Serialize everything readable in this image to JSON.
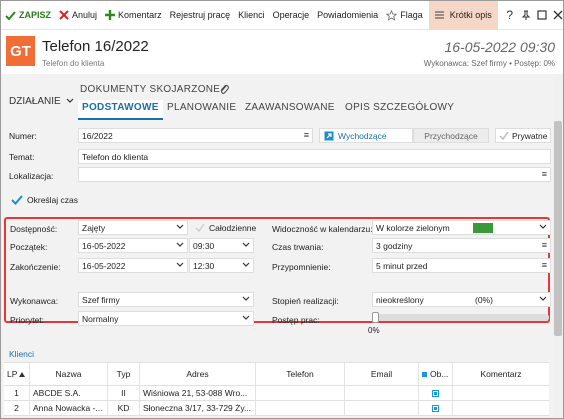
{
  "toolbar": {
    "save": "ZAPISZ",
    "cancel": "Anuluj",
    "comment": "Komentarz",
    "register_work": "Rejestruj pracę",
    "clients": "Klienci",
    "operations": "Operacje",
    "notifications": "Powiadomienia",
    "flag": "Flaga",
    "short_desc": "Krótki opis"
  },
  "header": {
    "badge": "GT",
    "title": "Telefon 16/2022",
    "subtitle": "Telefon do klienta",
    "date": "16-05-2022 09:30",
    "meta": "Wykonawca: Szef firmy  •  Postęp: 0%"
  },
  "tabs": {
    "action": "DZIAŁANIE",
    "documents": "DOKUMENTY SKOJARZONE",
    "items": [
      "PODSTAWOWE",
      "PLANOWANIE",
      "ZAAWANSOWANE",
      "OPIS SZCZEGÓŁOWY"
    ],
    "active": "PODSTAWOWE"
  },
  "form": {
    "number_label": "Numer:",
    "number_value": "16/2022",
    "direction_out": "Wychodzące",
    "direction_in": "Przychodzące",
    "private": "Prywatne",
    "topic_label": "Temat:",
    "topic_value": "Telefon do klienta",
    "location_label": "Lokalizacja:",
    "location_value": "",
    "set_time": "Określaj czas",
    "availability_label": "Dostępność:",
    "availability_value": "Zajęty",
    "all_day": "Całodzienne",
    "calendar_vis_label": "Widoczność w kalendarzu:",
    "calendar_vis_value": "W kolorze zielonym",
    "calendar_color": "#3a9a3a",
    "start_label": "Początek:",
    "start_date": "16-05-2022",
    "start_time": "09:30",
    "duration_label": "Czas trwania:",
    "duration_value": "3 godziny",
    "end_label": "Zakończenie:",
    "end_date": "16-05-2022",
    "end_time": "12:30",
    "reminder_label": "Przypomnienie:",
    "reminder_value": "5 minut przed",
    "executor_label": "Wykonawca:",
    "executor_value": "Szef firmy",
    "realization_label": "Stopień realizacji:",
    "realization_value": "nieokreślony",
    "realization_percent": "(0%)",
    "priority_label": "Priorytet:",
    "priority_value": "Normalny",
    "progress_label": "Postęp prac:",
    "progress_value": "0%",
    "progress_fraction": 0
  },
  "clients": {
    "label": "Klienci",
    "columns": [
      "LP",
      "Nazwa",
      "Typ",
      "Adres",
      "Telefon",
      "Email",
      "Ob...",
      "Komentarz"
    ],
    "rows": [
      {
        "lp": "1",
        "name": "ABCDE S.A.",
        "type": "II",
        "address": "Wiśniowa 21, 53-088 Wro...",
        "phone": "",
        "email": "",
        "comment": ""
      },
      {
        "lp": "2",
        "name": "Anna Nowacka -...",
        "type": "KD",
        "address": "Słoneczna 3/17, 33-729 Ży...",
        "phone": "",
        "email": "",
        "comment": ""
      }
    ]
  }
}
